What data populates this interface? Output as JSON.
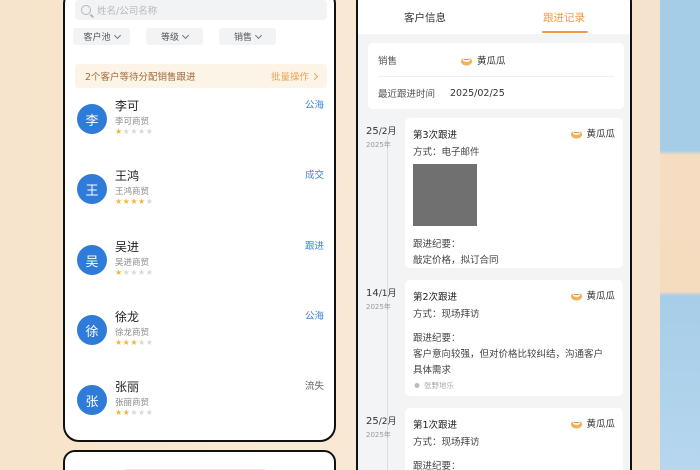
{
  "left_panel": {
    "search_placeholder": "姓名/公司名称",
    "filters": [
      "客户池",
      "等级",
      "销售"
    ],
    "banner": {
      "text": "2个客户等待分配销售跟进",
      "action": "批量操作"
    },
    "customers": [
      {
        "initial": "李",
        "name": "李可",
        "company": "李可商贸",
        "stars": 1,
        "tag": "公海",
        "tag_color": "#3d84d6"
      },
      {
        "initial": "王",
        "name": "王鸿",
        "company": "王鸿商贸",
        "stars": 4,
        "tag": "成交",
        "tag_color": "#3d84d6"
      },
      {
        "initial": "吴",
        "name": "吴进",
        "company": "吴进商贸",
        "stars": 1,
        "tag": "跟进",
        "tag_color": "#3d84d6"
      },
      {
        "initial": "徐",
        "name": "徐龙",
        "company": "徐龙商贸",
        "stars": 3,
        "tag": "公海",
        "tag_color": "#3d84d6"
      },
      {
        "initial": "张",
        "name": "张丽",
        "company": "张丽商贸",
        "stars": 2,
        "tag": "流失",
        "tag_color": "#666666"
      }
    ]
  },
  "right_panel": {
    "tabs": [
      {
        "label": "客户信息",
        "active": false
      },
      {
        "label": "跟进记录",
        "active": true
      }
    ],
    "info": {
      "sales_label": "销售",
      "sales_value": "黄瓜瓜",
      "last_label": "最近跟进时间",
      "last_value": "2025/02/25"
    },
    "records": [
      {
        "day": "25",
        "month": "/2月",
        "year": "2025年",
        "title": "第3次跟进",
        "owner": "黄瓜瓜",
        "method": "方式：电子邮件",
        "has_image": true,
        "summary_label": "跟进纪要：",
        "summary_lines": [
          "敲定价格，拟订合同"
        ],
        "note": ""
      },
      {
        "day": "14",
        "month": "/1月",
        "year": "2025年",
        "title": "第2次跟进",
        "owner": "黄瓜瓜",
        "method": "方式：现场拜访",
        "has_image": false,
        "summary_label": "跟进纪要：",
        "summary_lines": [
          "客户意向较强，但对价格比较纠结，沟通客户",
          "具体需求"
        ],
        "note": "张野地乐"
      },
      {
        "day": "25",
        "month": "/2月",
        "year": "2025年",
        "title": "第1次跟进",
        "owner": "黄瓜瓜",
        "method": "方式：现场拜访",
        "has_image": false,
        "summary_label": "跟进纪要：",
        "summary_lines": [],
        "note": ""
      }
    ]
  },
  "colors": {
    "accent": "#f29a3a",
    "avatar": "#2f7bd9",
    "star": "#f3b43b"
  }
}
